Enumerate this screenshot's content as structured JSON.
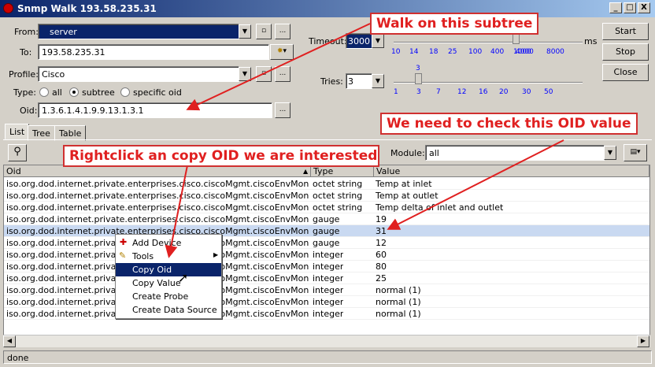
{
  "window": {
    "title": "Snmp Walk 193.58.235.31",
    "minimize": "_",
    "maximize": "□",
    "close": "X"
  },
  "form": {
    "from_label": "From:",
    "from_value": "server",
    "to_label": "To:",
    "to_value": "193.58.235.31",
    "profile_label": "Profile:",
    "profile_value": "Cisco",
    "type_label": "Type:",
    "type_all": "all",
    "type_subtree": "subtree",
    "type_specific": "specific oid",
    "oid_label": "Oid:",
    "oid_value": "1.3.6.1.4.1.9.9.13.1.3.1",
    "browse": "...",
    "small": "▫"
  },
  "timeout": {
    "label": "Timeout:",
    "value": "3000",
    "unit": "ms",
    "ticks": [
      "10",
      "14",
      "18",
      "25",
      "100",
      "400",
      "1000",
      "4000",
      "8000"
    ]
  },
  "tries": {
    "label": "Tries:",
    "value": "3",
    "current": "3",
    "ticks": [
      "1",
      "3",
      "7",
      "12",
      "16",
      "20",
      "30",
      "50"
    ]
  },
  "buttons": {
    "start": "Start",
    "stop": "Stop",
    "close": "Close"
  },
  "tabs": [
    "List",
    "Tree",
    "Table"
  ],
  "module": {
    "label": "Module:",
    "value": "all"
  },
  "table": {
    "headers": [
      "Oid",
      "Type",
      "Value"
    ],
    "rows": [
      {
        "oid": "iso.org.dod.internet.private.enterprises.cisco.ciscoMgmt.ciscoEnvMonMIB.cisc...",
        "type": "octet string",
        "value": "Temp at inlet"
      },
      {
        "oid": "iso.org.dod.internet.private.enterprises.cisco.ciscoMgmt.ciscoEnvMonMIB.cisc...",
        "type": "octet string",
        "value": "Temp at outlet"
      },
      {
        "oid": "iso.org.dod.internet.private.enterprises.cisco.ciscoMgmt.ciscoEnvMonMIB.cisc...",
        "type": "octet string",
        "value": "Temp delta of inlet and outlet"
      },
      {
        "oid": "iso.org.dod.internet.private.enterprises.cisco.ciscoMgmt.ciscoEnvMonMIB.cisc...",
        "type": "gauge",
        "value": "19"
      },
      {
        "oid": "iso.org.dod.internet.private.enterprises.cisco.ciscoMgmt.ciscoEnvMonMIB.cisc...",
        "type": "gauge",
        "value": "31"
      },
      {
        "oid": "iso.org.dod.internet.private.enterprises.cisco.ciscoMgmt.ciscoEnvMonMIB.cisc...",
        "type": "gauge",
        "value": "12"
      },
      {
        "oid": "iso.org.dod.internet.private.enterprises.cisco.ciscoMgmt.ciscoEnvMonMIB.cisc...",
        "type": "integer",
        "value": "60"
      },
      {
        "oid": "iso.org.dod.internet.private.enterprises.cisco.ciscoMgmt.ciscoEnvMonMIB.cisc...",
        "type": "integer",
        "value": "80"
      },
      {
        "oid": "iso.org.dod.internet.private.enterprises.cisco.ciscoMgmt.ciscoEnvMonMIB.cisc...",
        "type": "integer",
        "value": "25"
      },
      {
        "oid": "iso.org.dod.internet.private.enterprises.cisco.ciscoMgmt.ciscoEnvMonMIB.cisc...",
        "type": "integer",
        "value": "normal (1)"
      },
      {
        "oid": "iso.org.dod.internet.private.enterprises.cisco.ciscoMgmt.ciscoEnvMonMIB.cisc...",
        "type": "integer",
        "value": "normal (1)"
      },
      {
        "oid": "iso.org.dod.internet.private.enterprises.cisco.ciscoMgmt.ciscoEnvMonMIB.cisc...",
        "type": "integer",
        "value": "normal (1)"
      }
    ]
  },
  "context_menu": {
    "items": [
      "Add Device",
      "Tools",
      "Copy Oid",
      "Copy Value",
      "Create Probe",
      "Create Data Source"
    ]
  },
  "callouts": {
    "walk": "Walk on this subtree",
    "check": "We need to check this OID value",
    "rightclick": "Rightclick an copy OID we are interested i"
  },
  "status": "done",
  "colors": {
    "title_start": "#0a246a",
    "selection": "#0a246a",
    "callout": "#e02020"
  }
}
